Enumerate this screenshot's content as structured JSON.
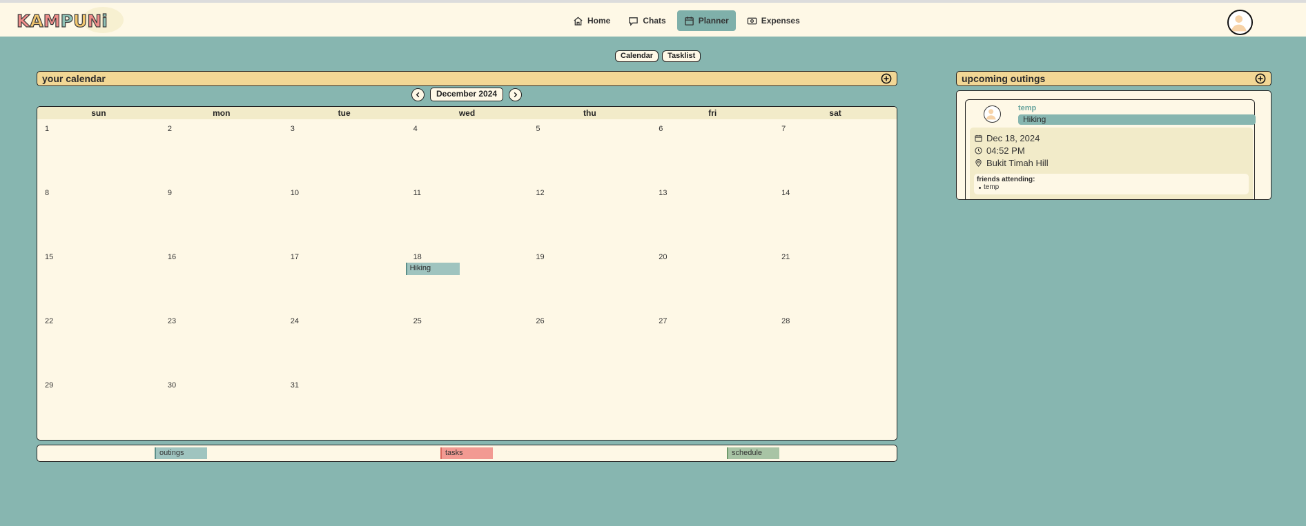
{
  "app": {
    "logo_text": "KAMPUNi"
  },
  "nav": {
    "items": [
      {
        "label": "Home",
        "icon": "home-icon",
        "active": false
      },
      {
        "label": "Chats",
        "icon": "chat-icon",
        "active": false
      },
      {
        "label": "Planner",
        "icon": "calendar-icon",
        "active": true
      },
      {
        "label": "Expenses",
        "icon": "money-icon",
        "active": false
      }
    ]
  },
  "view_toggle": {
    "calendar_label": "Calendar",
    "tasklist_label": "Tasklist"
  },
  "calendar": {
    "title": "your calendar",
    "month_label": "December 2024",
    "weekdays": [
      "sun",
      "mon",
      "tue",
      "wed",
      "thu",
      "fri",
      "sat"
    ],
    "days": [
      "1",
      "2",
      "3",
      "4",
      "5",
      "6",
      "7",
      "8",
      "9",
      "10",
      "11",
      "12",
      "13",
      "14",
      "15",
      "16",
      "17",
      "18",
      "19",
      "20",
      "21",
      "22",
      "23",
      "24",
      "25",
      "26",
      "27",
      "28",
      "29",
      "30",
      "31"
    ],
    "events": [
      {
        "day": "18",
        "label": "Hiking",
        "type": "outings"
      }
    ]
  },
  "legend": [
    {
      "label": "outings",
      "color": "#9fc4bf",
      "border": "#5c8f89"
    },
    {
      "label": "tasks",
      "color": "#f29a92",
      "border": "#d9665c"
    },
    {
      "label": "schedule",
      "color": "#a8c4a5",
      "border": "#6f9a6b"
    }
  ],
  "upcoming": {
    "title": "upcoming outings",
    "cards": [
      {
        "user": "temp",
        "activity": "Hiking",
        "date": "Dec 18, 2024",
        "time": "04:52 PM",
        "location": "Bukit Timah Hill",
        "friends_label": "friends attending:",
        "friends": [
          "temp"
        ]
      }
    ]
  },
  "colors": {
    "background": "#87b6b0",
    "panel": "#fef8e6",
    "header": "#f2d795",
    "accent": "#7fb0aa"
  }
}
